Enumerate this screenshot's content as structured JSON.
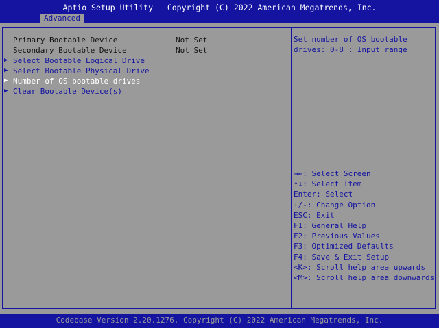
{
  "header": {
    "title": "Aptio Setup Utility – Copyright (C) 2022 American Megatrends, Inc.",
    "tabs": [
      {
        "label": "Advanced",
        "active": true
      }
    ]
  },
  "settings": {
    "items": [
      {
        "label": "Primary Bootable Device",
        "value": "Not Set",
        "type": "static"
      },
      {
        "label": "Secondary Bootable Device",
        "value": "Not Set",
        "type": "static"
      },
      {
        "label": "Select Bootable Logical Drive",
        "type": "submenu"
      },
      {
        "label": "Select Bootable Physical Drive",
        "type": "submenu"
      },
      {
        "label": "Number of OS bootable drives",
        "type": "submenu",
        "selected": true
      },
      {
        "label": "Clear Bootable Device(s)",
        "type": "submenu"
      }
    ],
    "submenu_marker": "▶"
  },
  "help": {
    "text": "Set number of OS bootable drives: 0-8 : Input range"
  },
  "keys": [
    "→←: Select Screen",
    "↑↓: Select Item",
    "Enter: Select",
    "+/-: Change Option",
    "ESC: Exit",
    "F1: General Help",
    "F2: Previous Values",
    "F3: Optimized Defaults",
    "F4: Save & Exit Setup",
    "<K>: Scroll help area upwards",
    "<M>: Scroll help area downwards"
  ],
  "footer": {
    "text": "Codebase Version 2.20.1276. Copyright (C) 2022 American Megatrends, Inc."
  },
  "colors": {
    "background_blue": "#1414a0",
    "panel_gray": "#9a9a9a",
    "highlight_white": "#ffffff"
  }
}
